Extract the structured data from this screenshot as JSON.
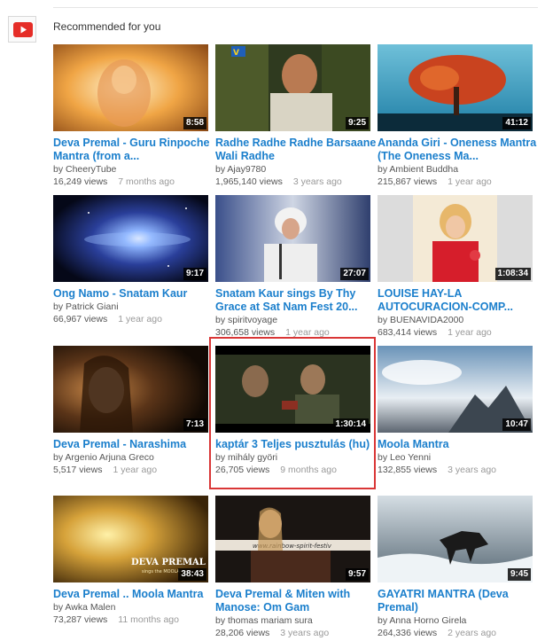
{
  "section": {
    "title": "Recommended for you"
  },
  "videos": [
    {
      "title": "Deva Premal - Guru Rinpoche Mantra (from a...",
      "channel": "by CheeryTube",
      "views": "16,249 views",
      "ago": "7 months ago",
      "duration": "8:58"
    },
    {
      "title": "Radhe Radhe Radhe Barsaane Wali Radhe",
      "channel": "by Ajay9780",
      "views": "1,965,140 views",
      "ago": "3 years ago",
      "duration": "9:25"
    },
    {
      "title": "Ananda Giri - Oneness Mantra (The Oneness Ma...",
      "channel": "by Ambient Buddha",
      "views": "215,867 views",
      "ago": "1 year ago",
      "duration": "41:12"
    },
    {
      "title": "Ong Namo - Snatam Kaur",
      "channel": "by Patrick Giani",
      "views": "66,967 views",
      "ago": "1 year ago",
      "duration": "9:17"
    },
    {
      "title": "Snatam Kaur sings By Thy Grace at Sat Nam Fest 20...",
      "channel": "by spiritvoyage",
      "views": "306,658 views",
      "ago": "1 year ago",
      "duration": "27:07"
    },
    {
      "title": "LOUISE HAY-LA AUTOCURACION-COMP...",
      "channel": "by BUENAVIDA2000",
      "views": "683,414 views",
      "ago": "1 year ago",
      "duration": "1:08:34"
    },
    {
      "title": "Deva Premal - Narashima",
      "channel": "by Argenio Arjuna Greco",
      "views": "5,517 views",
      "ago": "1 year ago",
      "duration": "7:13"
    },
    {
      "title": "kaptár 3 Teljes pusztulás (hu)",
      "channel": "by mihály györi",
      "views": "26,705 views",
      "ago": "9 months ago",
      "duration": "1:30:14"
    },
    {
      "title": "Moola Mantra",
      "channel": "by Leo Yenni",
      "views": "132,855 views",
      "ago": "3 years ago",
      "duration": "10:47"
    },
    {
      "title": "Deva Premal .. Moola Mantra",
      "channel": "by Awka Malen",
      "views": "73,287 views",
      "ago": "11 months ago",
      "duration": "38:43"
    },
    {
      "title": "Deva Premal & Miten with Manose: Om Gam",
      "channel": "by thomas mariam sura",
      "views": "28,206 views",
      "ago": "3 years ago",
      "duration": "9:57"
    },
    {
      "title": "GAYATRI MANTRA (Deva Premal)",
      "channel": "by Anna Horno Girela",
      "views": "264,336 views",
      "ago": "2 years ago",
      "duration": "9:45"
    }
  ],
  "thumb_overlays": {
    "v1_text": "DEVA PREMAL",
    "v1_sub": "sings the MOOLA",
    "v2_banner": "www.rainbow-spirit-festiv"
  },
  "colors": {
    "title_link": "#1b7fcc",
    "highlight_border": "#d93636",
    "youtube_red": "#e52d27"
  }
}
